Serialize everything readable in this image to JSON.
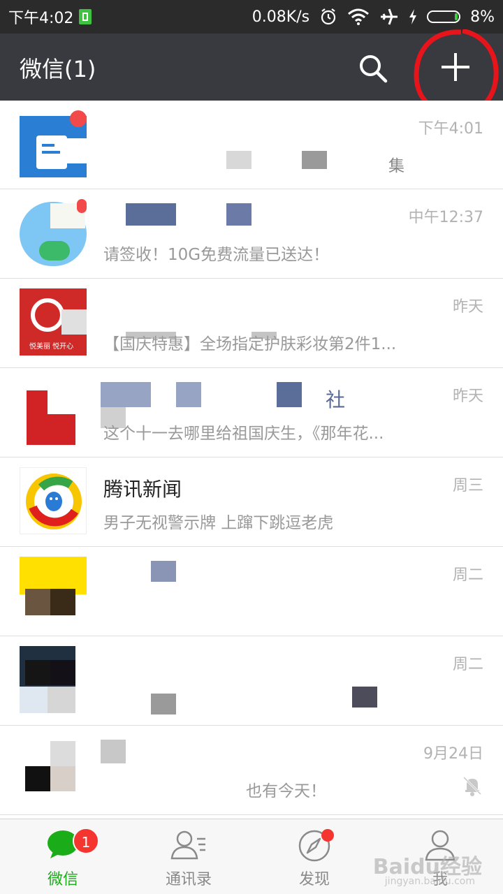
{
  "status": {
    "time": "下午4:02",
    "speed": "0.08K/s",
    "battery": "8%"
  },
  "header": {
    "title": "微信(1)"
  },
  "chats": [
    {
      "name": "",
      "preview": "集",
      "time": "下午4:01"
    },
    {
      "name": "",
      "preview": "请签收！10G免费流量已送达！",
      "time": "中午12:37"
    },
    {
      "name": "",
      "preview": "【国庆特惠】全场指定护肤彩妆第2件1...",
      "time": "昨天",
      "avatar_text": "悦美丽 悦开心"
    },
    {
      "name": "社",
      "preview": "这个十一去哪里给祖国庆生，《那年花...",
      "time": "昨天"
    },
    {
      "name": "腾讯新闻",
      "preview": "男子无视警示牌 上蹿下跳逗老虎",
      "time": "周三"
    },
    {
      "name": "",
      "preview": "",
      "time": "周二"
    },
    {
      "name": "",
      "preview": "",
      "time": "周二"
    },
    {
      "name": "",
      "preview": "也有今天！",
      "time": "9月24日"
    }
  ],
  "tabs": [
    {
      "label": "微信",
      "badge": "1"
    },
    {
      "label": "通讯录"
    },
    {
      "label": "发现"
    },
    {
      "label": "我"
    }
  ],
  "watermark": {
    "text": "Baidu经验",
    "sub": "jingyan.baidu.com"
  },
  "colors": {
    "accent": "#1aad19",
    "header": "#393a3f",
    "badge": "#f43530",
    "annotation": "#e8141c"
  }
}
